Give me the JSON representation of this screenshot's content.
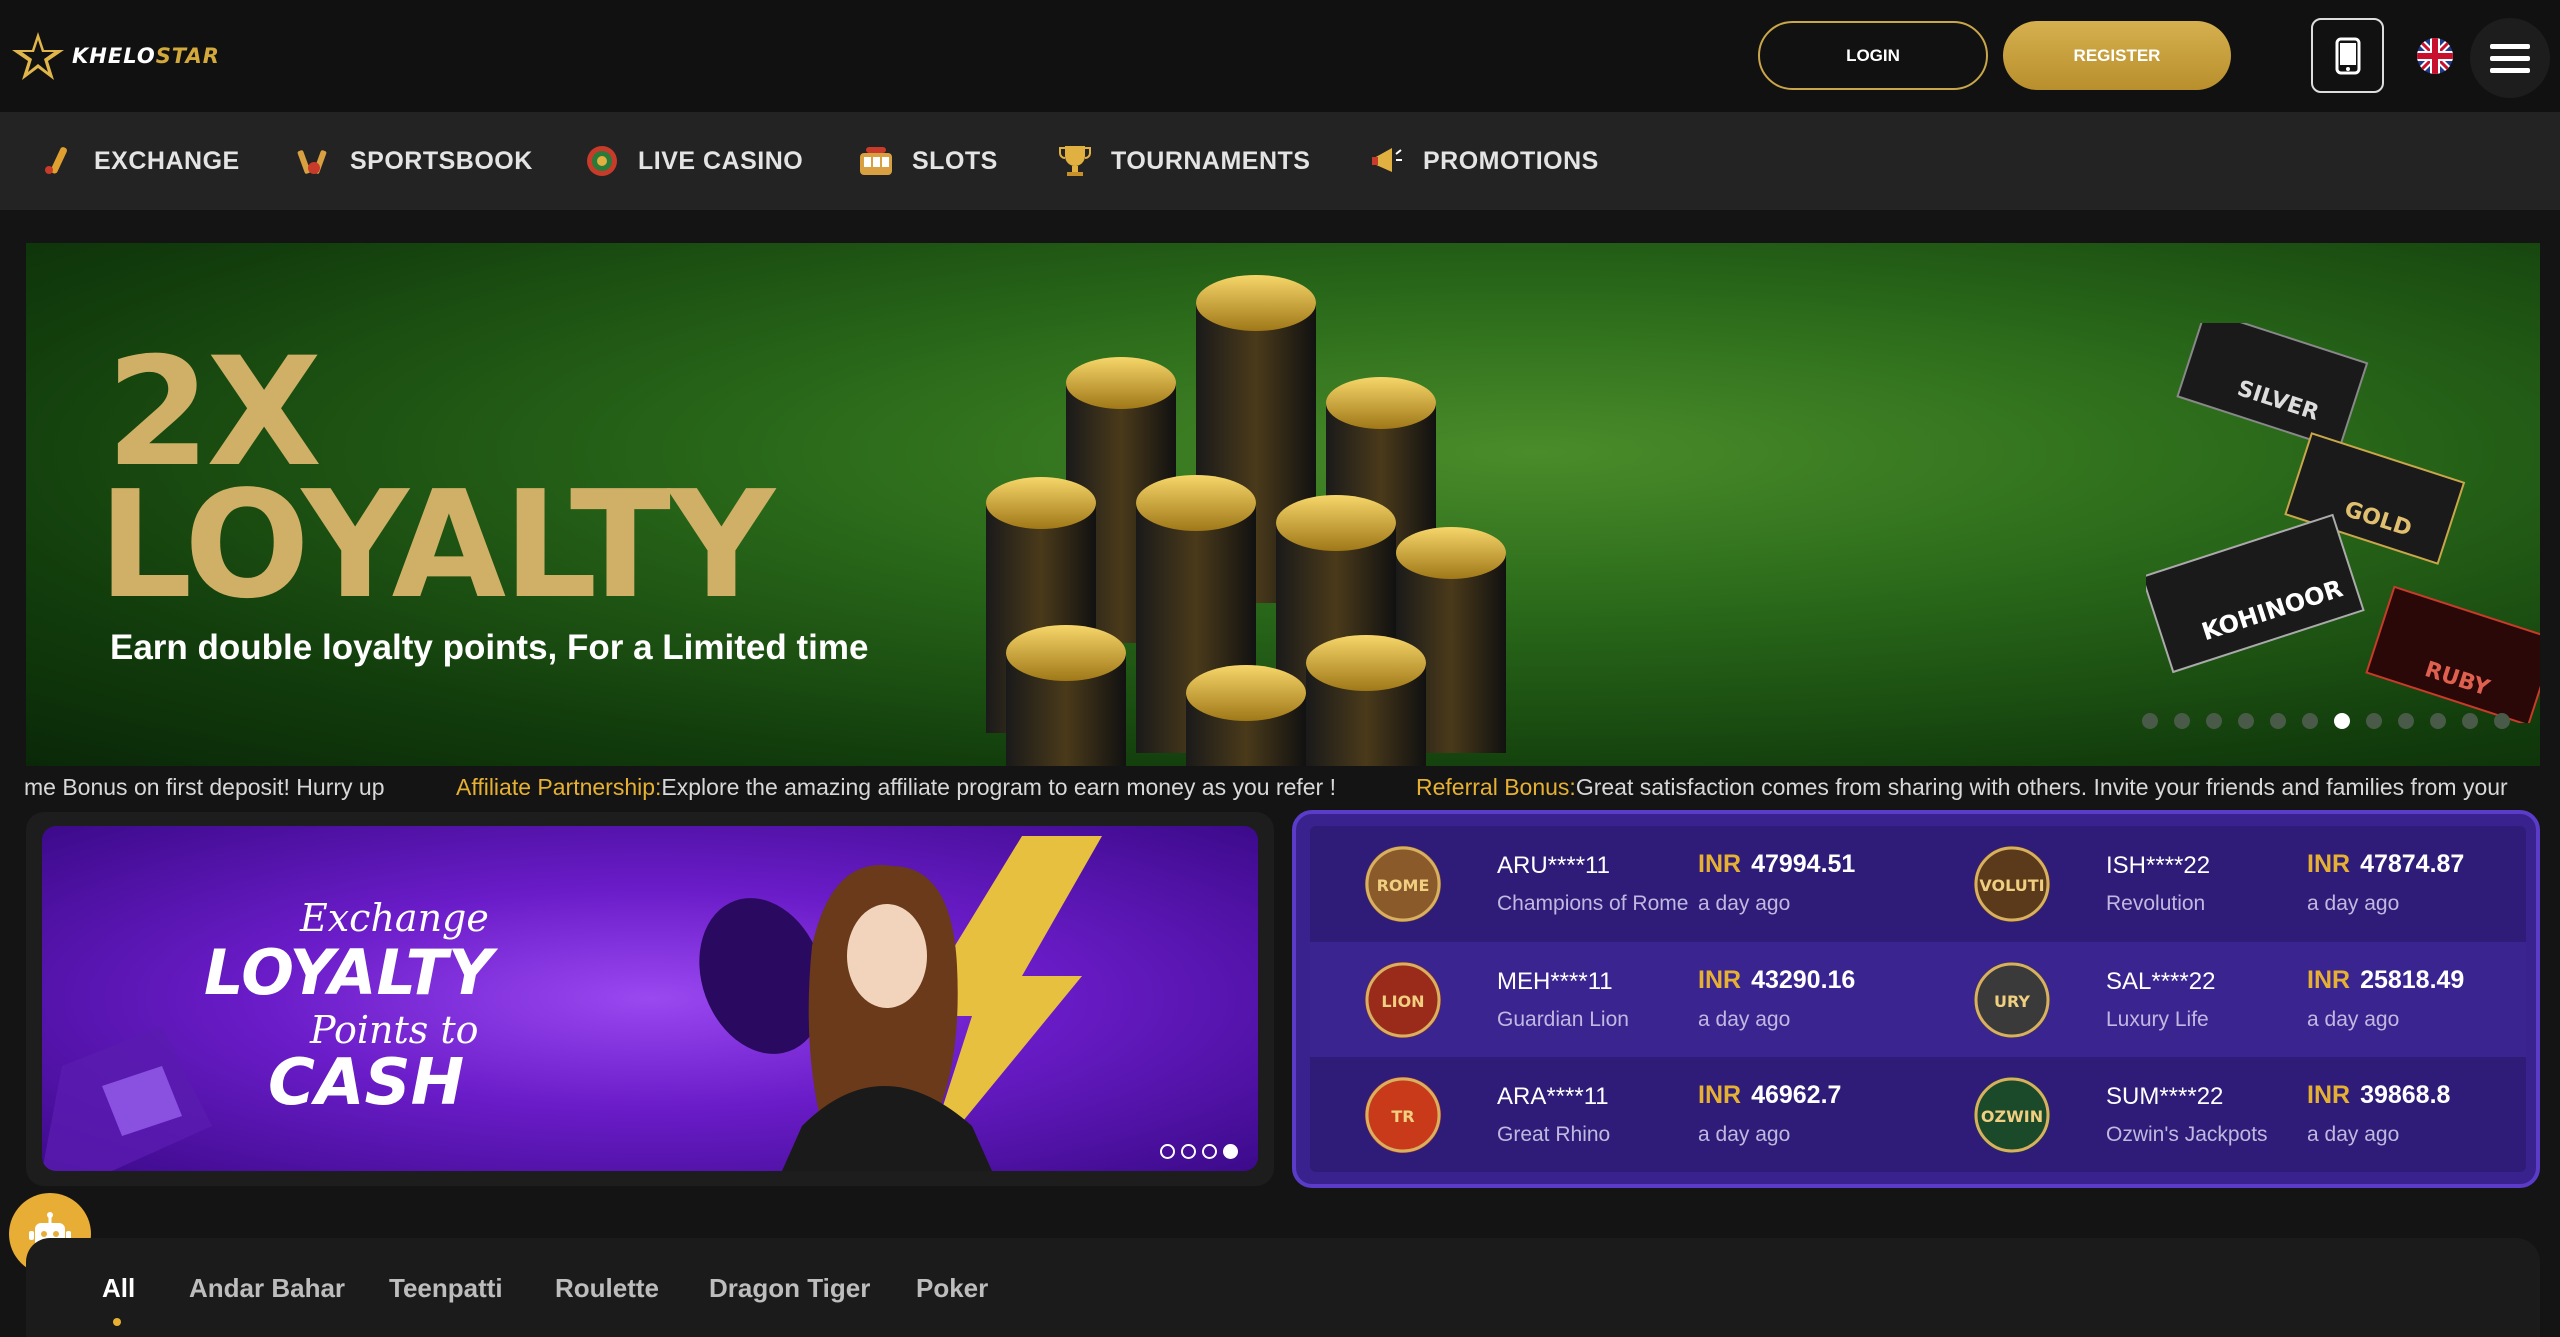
{
  "header": {
    "logo_text": "KHELOSTAR",
    "login_label": "LOGIN",
    "register_label": "REGISTER",
    "icons": [
      "mobile-icon",
      "uk-flag-icon",
      "hamburger-menu-icon"
    ]
  },
  "nav": {
    "items": [
      {
        "label": "EXCHANGE",
        "icon": "cricket-bat-icon"
      },
      {
        "label": "SPORTSBOOK",
        "icon": "sports-icon"
      },
      {
        "label": "LIVE CASINO",
        "icon": "roulette-wheel-icon"
      },
      {
        "label": "SLOTS",
        "icon": "slot-machine-icon"
      },
      {
        "label": "TOURNAMENTS",
        "icon": "trophy-icon"
      },
      {
        "label": "PROMOTIONS",
        "icon": "megaphone-icon"
      }
    ]
  },
  "hero": {
    "headline_1": "2X",
    "headline_2": "LOYALTY",
    "subtitle": "Earn double loyalty points, For a Limited time",
    "tier_labels": [
      "SILVER",
      "GOLD",
      "KOHINOOR",
      "RUBY"
    ],
    "slide_count": 12,
    "active_slide": 7
  },
  "ticker": {
    "items": [
      {
        "prefix": "",
        "text": "me Bonus on first deposit! Hurry up"
      },
      {
        "prefix": "Affiliate Partnership:",
        "text": "Explore the amazing affiliate program to earn money as you refer !"
      },
      {
        "prefix": "Referral Bonus:",
        "text": "Great satisfaction comes from sharing with others. Invite your friends and families from your"
      }
    ]
  },
  "promo": {
    "line_1": "Exchange",
    "line_2": "LOYALTY",
    "line_3": "Points to",
    "line_4": "CASH",
    "slide_count": 4,
    "active_slide": 4
  },
  "winners": {
    "currency": "INR",
    "rows": [
      [
        {
          "user": "ARU****11",
          "game": "Champions of Rome",
          "amount": "47994.51",
          "time": "a day ago",
          "avatar_text": "ROME",
          "avatar_color": "#8a5a2a"
        },
        {
          "user": "ISH****22",
          "game": "Revolution",
          "amount": "47874.87",
          "time": "a day ago",
          "avatar_text": "VOLUTI",
          "avatar_color": "#5a3a1a"
        }
      ],
      [
        {
          "user": "MEH****11",
          "game": "Guardian Lion",
          "amount": "43290.16",
          "time": "a day ago",
          "avatar_text": "LION",
          "avatar_color": "#9a2a1a"
        },
        {
          "user": "SAL****22",
          "game": "Luxury Life",
          "amount": "25818.49",
          "time": "a day ago",
          "avatar_text": "URY",
          "avatar_color": "#3a3a3a"
        }
      ],
      [
        {
          "user": "ARA****11",
          "game": "Great Rhino",
          "amount": "46962.7",
          "time": "a day ago",
          "avatar_text": "TR",
          "avatar_color": "#c83a1a"
        },
        {
          "user": "SUM****22",
          "game": "Ozwin's Jackpots",
          "amount": "39868.8",
          "time": "a day ago",
          "avatar_text": "OZWIN",
          "avatar_color": "#1a4a2a"
        }
      ]
    ]
  },
  "game_tabs": {
    "items": [
      "All",
      "Andar Bahar",
      "Teenpatti",
      "Roulette",
      "Dragon Tiger",
      "Poker"
    ],
    "active": "All"
  },
  "chat": {
    "icon": "robot-chat-icon"
  }
}
